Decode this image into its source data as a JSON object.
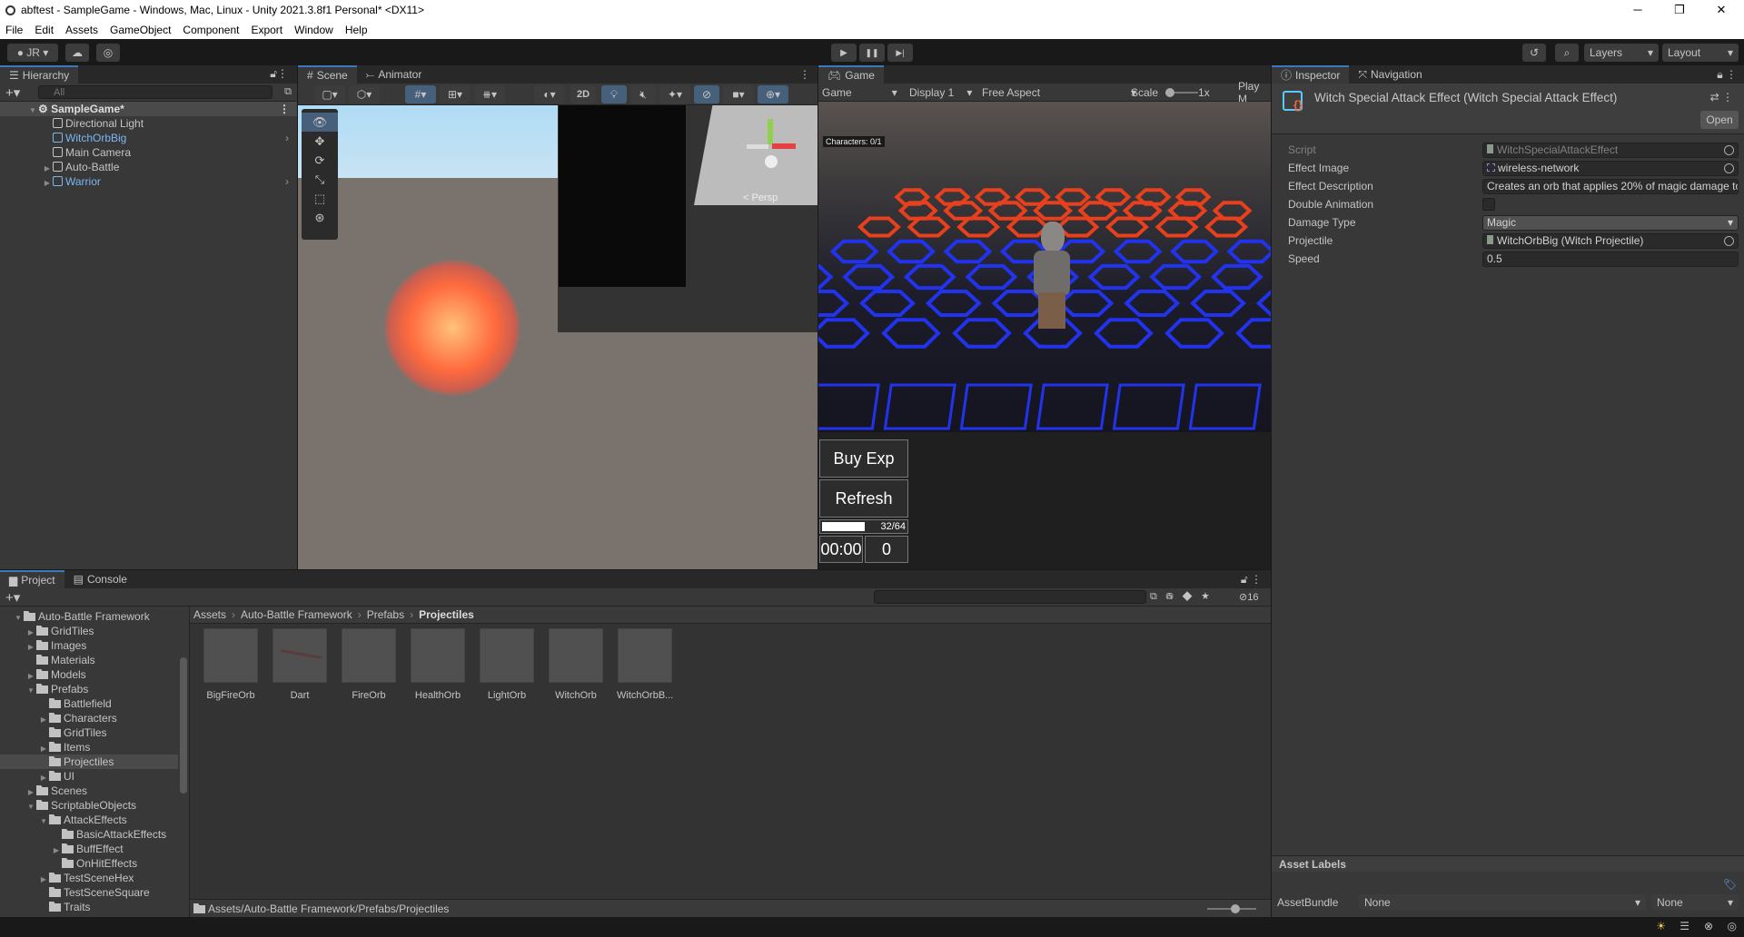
{
  "window": {
    "title": "abftest - SampleGame - Windows, Mac, Linux - Unity 2021.3.8f1 Personal* <DX11>",
    "minimize": "─",
    "maximize": "❐",
    "close": "✕"
  },
  "menu": [
    "File",
    "Edit",
    "Assets",
    "GameObject",
    "Component",
    "Export",
    "Window",
    "Help"
  ],
  "toolbar": {
    "account": "JR",
    "play": "▶",
    "pause": "❚❚",
    "step": "▶|",
    "layers": "Layers",
    "layout": "Layout"
  },
  "hierarchy": {
    "tab": "Hierarchy",
    "search_placeholder": "All",
    "scene": "SampleGame*",
    "items": [
      {
        "label": "Directional Light",
        "prefab": false,
        "expandable": false
      },
      {
        "label": "WitchOrbBig",
        "prefab": true,
        "expandable": false
      },
      {
        "label": "Main Camera",
        "prefab": false,
        "expandable": false
      },
      {
        "label": "Auto-Battle",
        "prefab": false,
        "expandable": true
      },
      {
        "label": "Warrior",
        "prefab": true,
        "expandable": true
      }
    ]
  },
  "scene": {
    "tabs": [
      "Scene",
      "Animator"
    ],
    "mode_2d": "2D",
    "persp": "< Persp"
  },
  "game": {
    "tab": "Game",
    "display_mode": "Game",
    "display": "Display 1",
    "aspect": "Free Aspect",
    "scale_label": "Scale",
    "scale": "1x",
    "play_mode": "Play M",
    "characters": "Characters: 0/1",
    "buy_exp": "Buy Exp",
    "refresh": "Refresh",
    "exp": "32/64",
    "exp_fraction": 0.5,
    "timer": "00:00",
    "gold": "0"
  },
  "inspector": {
    "tabs": [
      "Inspector",
      "Navigation"
    ],
    "title": "Witch Special Attack Effect (Witch Special Attack Effect)",
    "open": "Open",
    "fields": [
      {
        "label": "Script",
        "value": "WitchSpecialAttackEffect"
      },
      {
        "label": "Effect Image",
        "value": "wireless-network"
      },
      {
        "label": "Effect Description",
        "value": "Creates an orb that applies 20% of magic damage to"
      },
      {
        "label": "Double Animation",
        "value": ""
      },
      {
        "label": "Damage Type",
        "value": "Magic"
      },
      {
        "label": "Projectile",
        "value": "WitchOrbBig (Witch Projectile)"
      },
      {
        "label": "Speed",
        "value": "0.5"
      }
    ],
    "double_animation": false,
    "asset_labels": "Asset Labels",
    "assetbundle_label": "AssetBundle",
    "assetbundle": "None",
    "variant": "None"
  },
  "project": {
    "tabs": [
      "Project",
      "Console"
    ],
    "hidden_count": "16",
    "tree": [
      {
        "label": "Auto-Battle Framework",
        "depth": 0,
        "state": "open"
      },
      {
        "label": "GridTiles",
        "depth": 1,
        "state": "closed"
      },
      {
        "label": "Images",
        "depth": 1,
        "state": "closed"
      },
      {
        "label": "Materials",
        "depth": 1,
        "state": "none"
      },
      {
        "label": "Models",
        "depth": 1,
        "state": "closed"
      },
      {
        "label": "Prefabs",
        "depth": 1,
        "state": "open"
      },
      {
        "label": "Battlefield",
        "depth": 2,
        "state": "none"
      },
      {
        "label": "Characters",
        "depth": 2,
        "state": "closed"
      },
      {
        "label": "GridTiles",
        "depth": 2,
        "state": "none"
      },
      {
        "label": "Items",
        "depth": 2,
        "state": "closed"
      },
      {
        "label": "Projectiles",
        "depth": 2,
        "state": "none",
        "selected": true
      },
      {
        "label": "UI",
        "depth": 2,
        "state": "closed"
      },
      {
        "label": "Scenes",
        "depth": 1,
        "state": "closed"
      },
      {
        "label": "ScriptableObjects",
        "depth": 1,
        "state": "open"
      },
      {
        "label": "AttackEffects",
        "depth": 2,
        "state": "open"
      },
      {
        "label": "BasicAttackEffects",
        "depth": 3,
        "state": "none"
      },
      {
        "label": "BuffEffect",
        "depth": 3,
        "state": "closed"
      },
      {
        "label": "OnHitEffects",
        "depth": 3,
        "state": "none"
      },
      {
        "label": "TestSceneHex",
        "depth": 2,
        "state": "closed"
      },
      {
        "label": "TestSceneSquare",
        "depth": 2,
        "state": "none"
      },
      {
        "label": "Traits",
        "depth": 2,
        "state": "none"
      }
    ],
    "breadcrumb": [
      "Assets",
      "Auto-Battle Framework",
      "Prefabs",
      "Projectiles"
    ],
    "assets": [
      "BigFireOrb",
      "Dart",
      "FireOrb",
      "HealthOrb",
      "LightOrb",
      "WitchOrb",
      "WitchOrbB..."
    ],
    "path": "Assets/Auto-Battle Framework/Prefabs/Projectiles"
  }
}
